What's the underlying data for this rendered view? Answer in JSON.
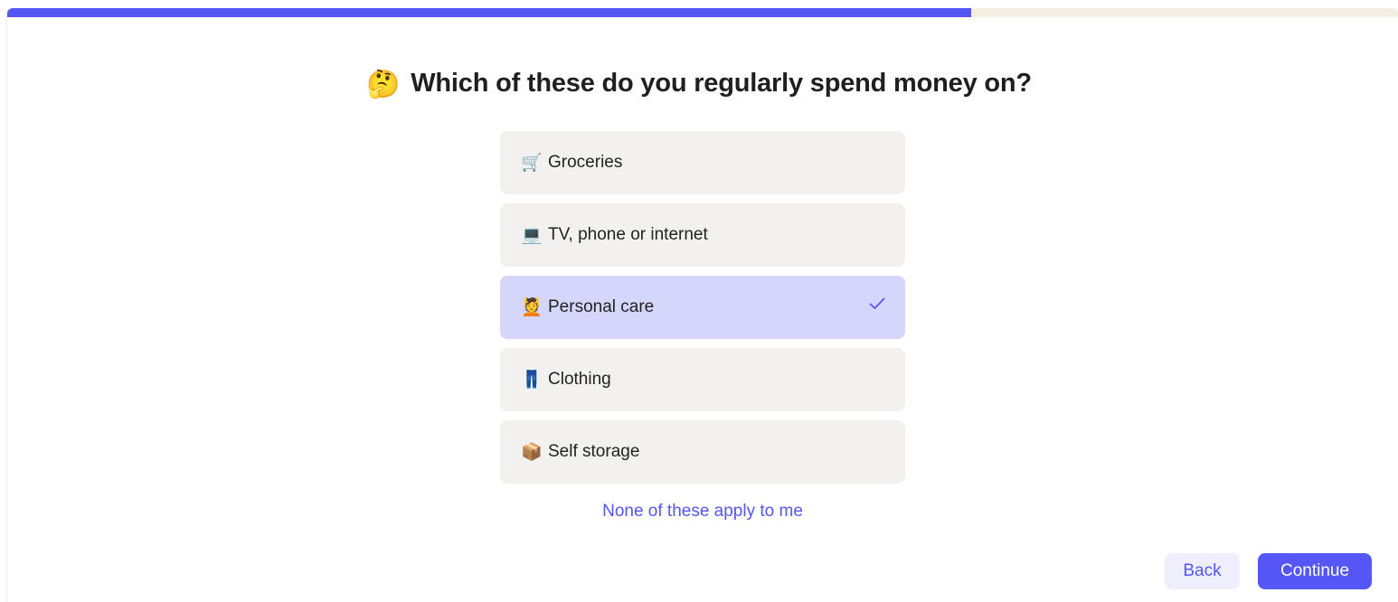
{
  "progress": {
    "fraction": 0.693,
    "fill_color": "#5457f5",
    "track_color": "#f3ede2"
  },
  "question": {
    "emoji": "🤔",
    "emoji_icon": "thinking-face-icon",
    "text": "Which of these do you regularly spend money on?"
  },
  "options": [
    {
      "emoji": "🛒",
      "icon": "shopping-cart-icon",
      "label": "Groceries",
      "selected": false
    },
    {
      "emoji": "💻",
      "icon": "laptop-icon",
      "label": "TV, phone or internet",
      "selected": false
    },
    {
      "emoji": "💆",
      "icon": "person-getting-massage-icon",
      "label": "Personal care",
      "selected": true
    },
    {
      "emoji": "👖",
      "icon": "jeans-icon",
      "label": "Clothing",
      "selected": false
    },
    {
      "emoji": "📦",
      "icon": "package-icon",
      "label": "Self storage",
      "selected": false
    }
  ],
  "none_link": "None of these apply to me",
  "buttons": {
    "back": "Back",
    "continue": "Continue"
  },
  "colors": {
    "accent": "#5457f5",
    "option_bg": "#f2f1ef",
    "option_selected_bg": "#d5d6fb"
  }
}
